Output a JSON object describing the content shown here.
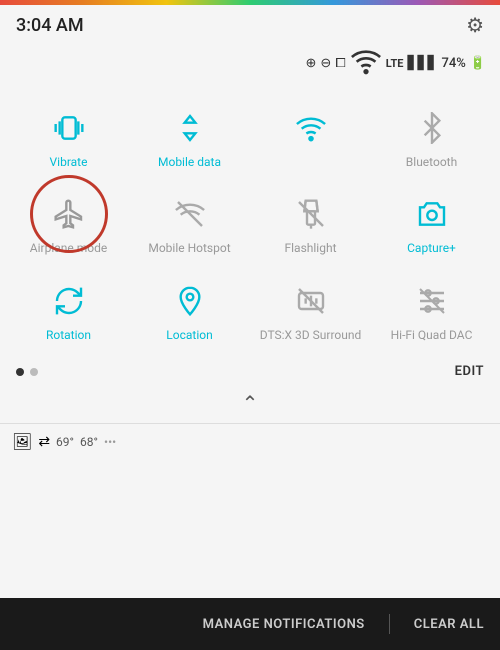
{
  "statusBar": {
    "time": "3:04 AM",
    "battery": "74%"
  },
  "tiles": {
    "row1": [
      {
        "id": "vibrate",
        "label": "Vibrate",
        "active": true
      },
      {
        "id": "mobile-data",
        "label": "Mobile data",
        "active": true
      },
      {
        "id": "wifi",
        "label": "",
        "active": true
      },
      {
        "id": "bluetooth",
        "label": "Bluetooth",
        "active": false
      }
    ],
    "row2": [
      {
        "id": "airplane",
        "label": "Airplane mode",
        "active": false,
        "circled": true
      },
      {
        "id": "hotspot",
        "label": "Mobile Hotspot",
        "active": false
      },
      {
        "id": "flashlight",
        "label": "Flashlight",
        "active": false
      },
      {
        "id": "capture",
        "label": "Capture+",
        "active": true
      }
    ],
    "row3": [
      {
        "id": "rotation",
        "label": "Rotation",
        "active": true
      },
      {
        "id": "location",
        "label": "Location",
        "active": true
      },
      {
        "id": "dts",
        "label": "DTS:X 3D Surround",
        "active": false
      },
      {
        "id": "hifi",
        "label": "Hi-Fi Quad DAC",
        "active": false
      }
    ]
  },
  "pagination": {
    "page1": "active",
    "page2": "inactive",
    "editLabel": "EDIT"
  },
  "notifBar": {
    "temp1": "69°",
    "temp2": "68°"
  },
  "footer": {
    "manageLabel": "MANAGE NOTIFICATIONS",
    "clearLabel": "CLEAR ALL"
  }
}
